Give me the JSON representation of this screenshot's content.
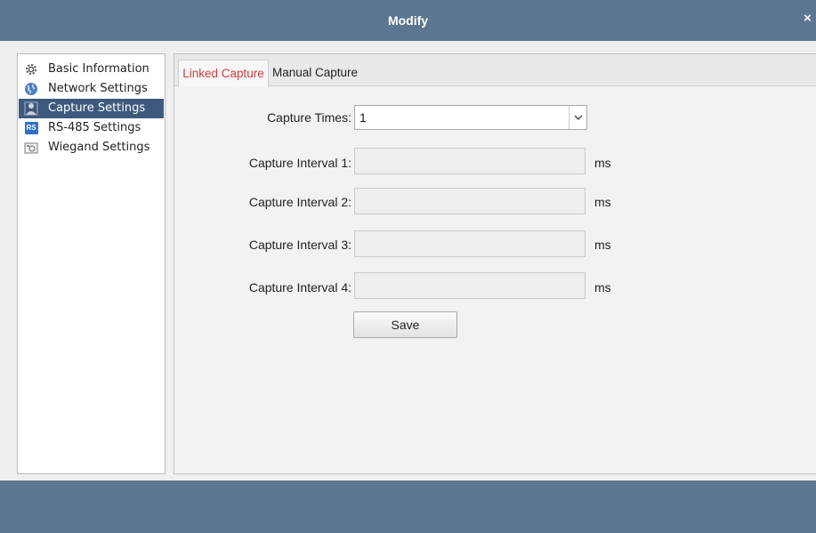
{
  "window": {
    "title": "Modify",
    "close_label": "×"
  },
  "sidebar": {
    "items": [
      {
        "label": "Basic Information",
        "icon": "gear-icon",
        "selected": false
      },
      {
        "label": "Network Settings",
        "icon": "globe-icon",
        "selected": false
      },
      {
        "label": "Capture Settings",
        "icon": "camera-person-icon",
        "selected": true
      },
      {
        "label": "RS-485 Settings",
        "icon": "rs-badge-icon",
        "icon_text": "RS",
        "selected": false
      },
      {
        "label": "Wiegand Settings",
        "icon": "card-reader-icon",
        "selected": false
      }
    ]
  },
  "tabs": [
    {
      "label": "Linked Capture",
      "active": true
    },
    {
      "label": "Manual Capture",
      "active": false
    }
  ],
  "form": {
    "capture_times": {
      "label": "Capture Times:",
      "value": "1"
    },
    "intervals": [
      {
        "label": "Capture Interval 1:",
        "value": "",
        "unit": "ms"
      },
      {
        "label": "Capture Interval 2:",
        "value": "",
        "unit": "ms"
      },
      {
        "label": "Capture Interval 3:",
        "value": "",
        "unit": "ms"
      },
      {
        "label": "Capture Interval 4:",
        "value": "",
        "unit": "ms"
      }
    ],
    "save_label": "Save"
  },
  "colors": {
    "titlebar": "#5c7691",
    "selected_item": "#3d5a7d",
    "active_tab_text": "#d03d3d"
  }
}
